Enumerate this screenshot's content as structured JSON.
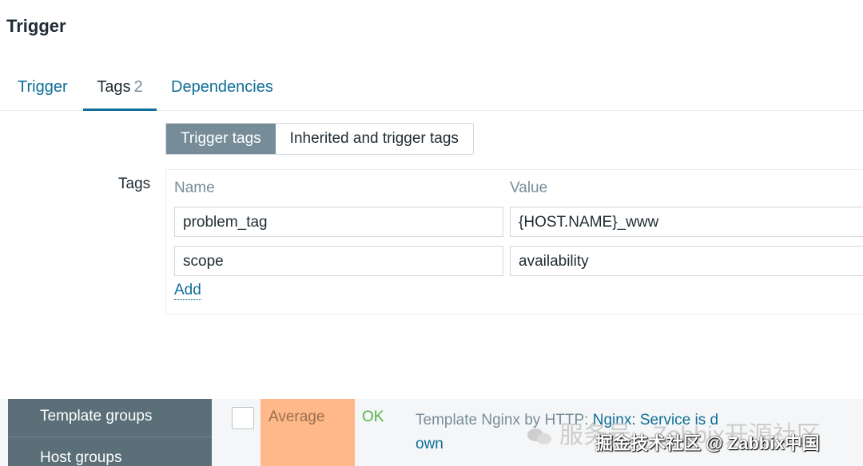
{
  "page": {
    "title": "Trigger"
  },
  "tabs": [
    {
      "label": "Trigger"
    },
    {
      "label": "Tags",
      "count": "2"
    },
    {
      "label": "Dependencies"
    }
  ],
  "tag_filter": {
    "active": "Trigger tags",
    "inactive": "Inherited and trigger tags"
  },
  "tags_form": {
    "label": "Tags",
    "column_name": "Name",
    "column_value": "Value",
    "rows": [
      {
        "name": "problem_tag",
        "value": "{HOST.NAME}_www"
      },
      {
        "name": "scope",
        "value": "availability"
      }
    ],
    "add_label": "Add"
  },
  "background_list": {
    "sidebar_items": [
      "Template groups",
      "Host groups"
    ],
    "severity": "Average",
    "severity_color": "#ffb88a",
    "status": "OK",
    "problem_prefix": "Template Nginx by HTTP: ",
    "problem_link": "Nginx: Service is d",
    "problem_link_cont": "own"
  },
  "overlay": {
    "watermark": "服务号 · Zabbix开源社区",
    "credit": "掘金技术社区 @ Zabbix中国"
  }
}
